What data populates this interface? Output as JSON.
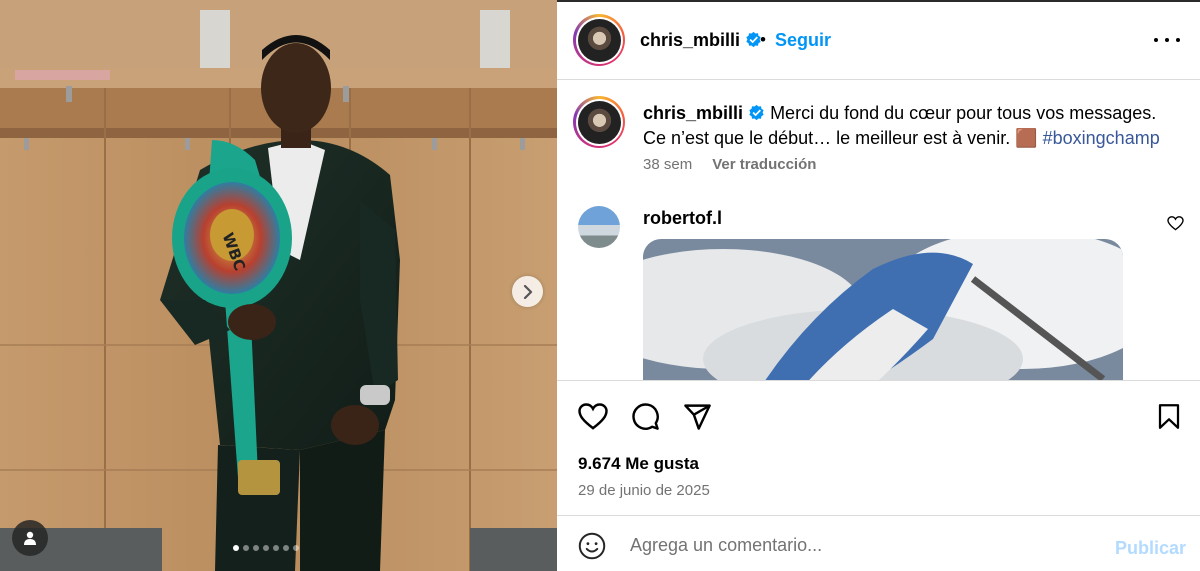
{
  "media": {
    "carousel": {
      "count": 7,
      "active_index": 0
    },
    "belt_text": "WBC"
  },
  "header": {
    "username": "chris_mbilli",
    "separator": "•",
    "follow_label": "Seguir"
  },
  "caption": {
    "username": "chris_mbilli",
    "text": " Merci du fond du cœur pour tous vos messages. Ce n’est que le début… le meilleur est à venir. 🟫 ",
    "hashtag": "#boxingchamp",
    "age": "38 sem",
    "translate_label": "Ver traducción"
  },
  "comment": {
    "username": "robertof.l"
  },
  "stats": {
    "likes": "9.674 Me gusta",
    "date": "29 de junio de 2025"
  },
  "add_comment": {
    "placeholder": "Agrega un comentario...",
    "publish_label": "Publicar"
  },
  "colors": {
    "accent": "#0095f6",
    "publish_disabled": "#b3dbff",
    "muted": "#737373",
    "hashtag": "#385898"
  },
  "icons": [
    "verified-icon",
    "more-icon",
    "heart-icon",
    "comment-icon",
    "share-icon",
    "save-icon",
    "emoji-icon",
    "chevron-right-icon",
    "user-tag-icon"
  ]
}
